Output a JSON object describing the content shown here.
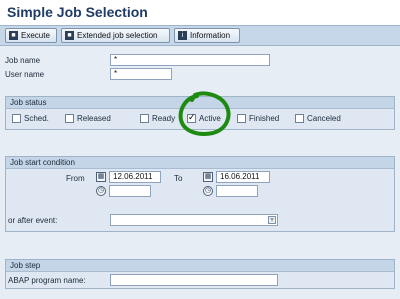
{
  "title": "Simple Job Selection",
  "toolbar": {
    "execute": "Execute",
    "extended": "Extended job selection",
    "information": "Information"
  },
  "fields": {
    "job_name_label": "Job name",
    "job_name_value": "*",
    "user_name_label": "User name",
    "user_name_value": "*"
  },
  "job_status": {
    "title": "Job status",
    "options": [
      {
        "label": "Sched.",
        "checked": false
      },
      {
        "label": "Released",
        "checked": false
      },
      {
        "label": "Ready",
        "checked": false
      },
      {
        "label": "Active",
        "checked": true
      },
      {
        "label": "Finished",
        "checked": false
      },
      {
        "label": "Canceled",
        "checked": false
      }
    ],
    "highlight_color": "#1e8a12"
  },
  "start_condition": {
    "title": "Job start condition",
    "from_label": "From",
    "from_date": "12.06.2011",
    "to_label": "To",
    "to_date": "16.06.2011",
    "event_label": "or after event:"
  },
  "job_step": {
    "title": "Job step",
    "abap_label": "ABAP program name:"
  },
  "icons": {
    "execute": "execute-icon",
    "extended": "extended-selection-icon",
    "information": "information-icon",
    "calendar": "calendar-icon",
    "clock": "clock-icon"
  }
}
